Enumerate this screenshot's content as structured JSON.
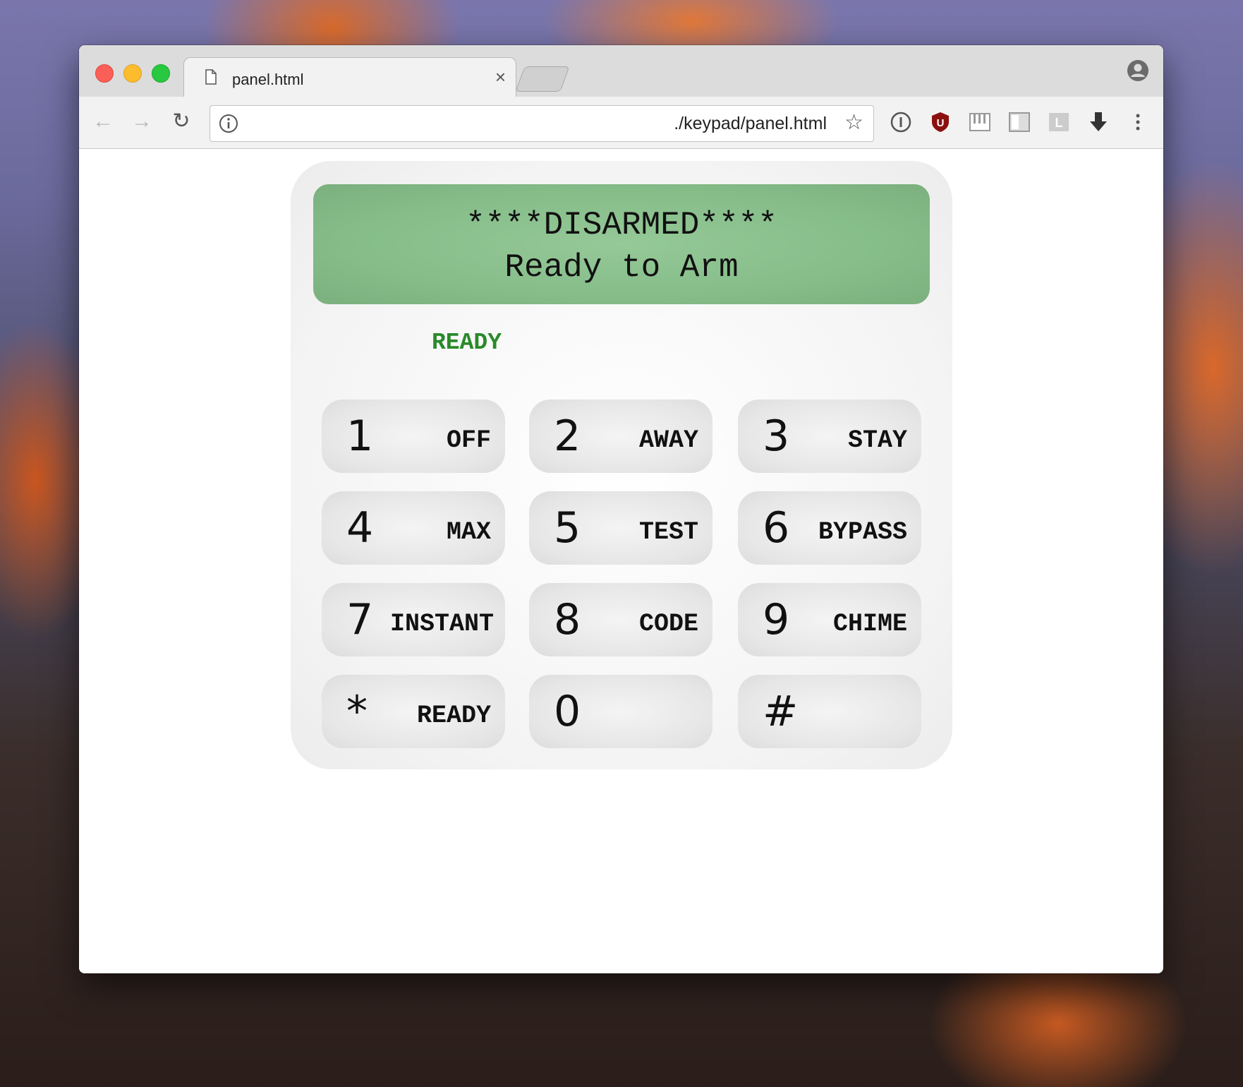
{
  "browser": {
    "tab_title": "panel.html",
    "tab_close": "×",
    "url": "./keypad/panel.html"
  },
  "display": {
    "line1": "****DISARMED****",
    "line2": "Ready to Arm"
  },
  "status_text": "READY",
  "keypad": {
    "k1": {
      "num": "1",
      "fn": "OFF"
    },
    "k2": {
      "num": "2",
      "fn": "AWAY"
    },
    "k3": {
      "num": "3",
      "fn": "STAY"
    },
    "k4": {
      "num": "4",
      "fn": "MAX"
    },
    "k5": {
      "num": "5",
      "fn": "TEST"
    },
    "k6": {
      "num": "6",
      "fn": "BYPASS"
    },
    "k7": {
      "num": "7",
      "fn": "INSTANT"
    },
    "k8": {
      "num": "8",
      "fn": "CODE"
    },
    "k9": {
      "num": "9",
      "fn": "CHIME"
    },
    "kstar": {
      "num": "*",
      "fn": "READY"
    },
    "k0": {
      "num": "0",
      "fn": ""
    },
    "khash": {
      "num": "#",
      "fn": ""
    }
  },
  "colors": {
    "lcd": "#8cc38f",
    "status_green": "#2a8a2a"
  }
}
